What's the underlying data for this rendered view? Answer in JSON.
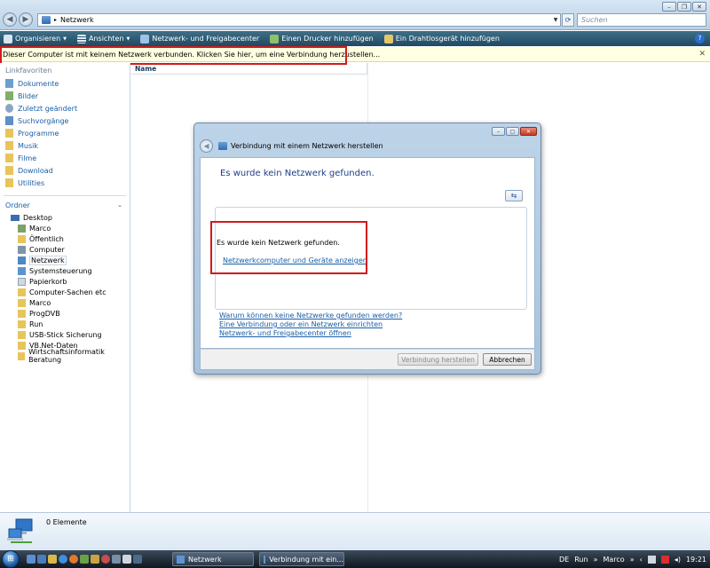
{
  "address": {
    "path": "Netzwerk",
    "search_placeholder": "Suchen"
  },
  "toolbar": {
    "organize": "Organisieren",
    "views": "Ansichten",
    "network_center": "Netzwerk- und Freigabecenter",
    "add_printer": "Einen Drucker hinzufügen",
    "add_wireless": "Ein Drahtlosgerät hinzufügen"
  },
  "infobar": {
    "text": "Dieser Computer ist mit keinem Netzwerk verbunden. Klicken Sie hier, um eine Verbindung herzustellen..."
  },
  "sidebar": {
    "title": "Linkfavoriten",
    "favorites": [
      "Dokumente",
      "Bilder",
      "Zuletzt geändert",
      "Suchvorgänge",
      "Programme",
      "Musik",
      "Filme",
      "Download",
      "Utilities"
    ],
    "folders_title": "Ordner",
    "tree_root": "Desktop",
    "tree": [
      "Marco",
      "Öffentlich",
      "Computer",
      "Netzwerk",
      "Systemsteuerung",
      "Papierkorb",
      "Computer-Sachen etc",
      "Marco",
      "ProgDVB",
      "Run",
      "USB-Stick Sicherung",
      "VB.Net-Daten",
      "Wirtschaftsinformatik Beratung"
    ]
  },
  "main": {
    "column_name": "Name"
  },
  "details": {
    "count": "0 Elemente"
  },
  "dialog": {
    "title": "Verbindung mit einem Netzwerk herstellen",
    "heading": "Es wurde kein Netzwerk gefunden.",
    "message": "Es wurde kein Netzwerk gefunden.",
    "show_link": "Netzwerkcomputer und Geräte anzeigen",
    "links": [
      "Warum können keine Netzwerke gefunden werden?",
      "Eine Verbindung oder ein Netzwerk einrichten",
      "Netzwerk- und Freigabecenter öffnen"
    ],
    "connect_button": "Verbindung herstellen",
    "cancel_button": "Abbrechen"
  },
  "taskbar": {
    "tasks": [
      "Netzwerk",
      "Verbindung mit ein..."
    ],
    "language": "DE",
    "run": "Run",
    "user": "Marco",
    "time": "19:21"
  }
}
